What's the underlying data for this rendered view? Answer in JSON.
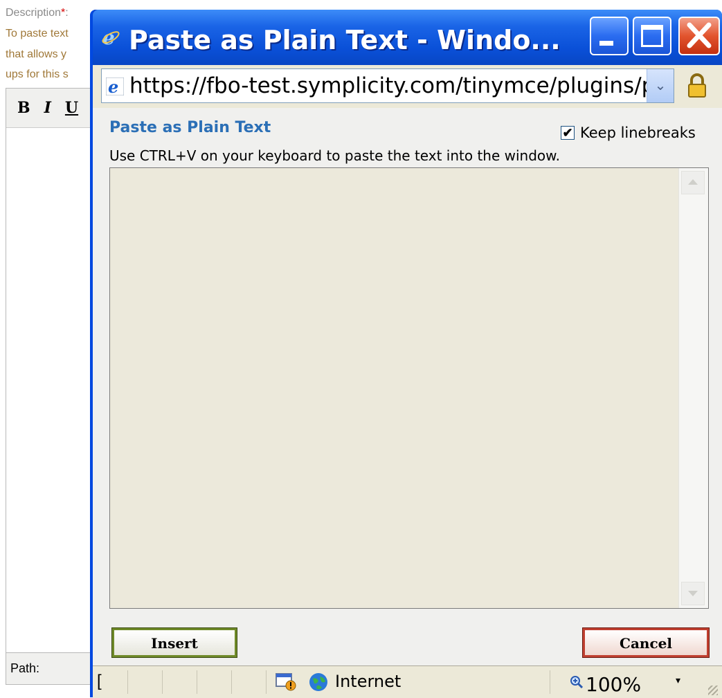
{
  "background_page": {
    "description_label": "Description",
    "required_marker": "*",
    "description_suffix": ":",
    "help_lines": [
      "To paste text",
      "that allows y",
      "ups for this s"
    ],
    "toolbar": {
      "bold": "B",
      "italic": "I",
      "underline": "U"
    },
    "path_label": "Path:"
  },
  "window": {
    "title": "Paste as Plain Text - Windo...",
    "address_url": "https://fbo-test.symplicity.com/tinymce/plugins/paste/",
    "icons": [
      "ie-icon",
      "minimize-icon",
      "maximize-icon",
      "close-icon",
      "lock-icon"
    ]
  },
  "dialog": {
    "title": "Paste as Plain Text",
    "keep_linebreaks_label": "Keep linebreaks",
    "keep_linebreaks_checked": true,
    "check_glyph": "✔",
    "instructions": "Use CTRL+V on your keyboard to paste the text into the window.",
    "textarea_value": "",
    "insert_label": "Insert",
    "cancel_label": "Cancel"
  },
  "statusbar": {
    "left_glyph": "[",
    "zone": "Internet",
    "zoom": "100%",
    "zoom_dropdown_glyph": "▾"
  },
  "colors": {
    "titlebar_blue": "#0a50d8",
    "dialog_title": "#2b6fb6",
    "insert_border": "#6f8a28",
    "cancel_border": "#c04030"
  }
}
